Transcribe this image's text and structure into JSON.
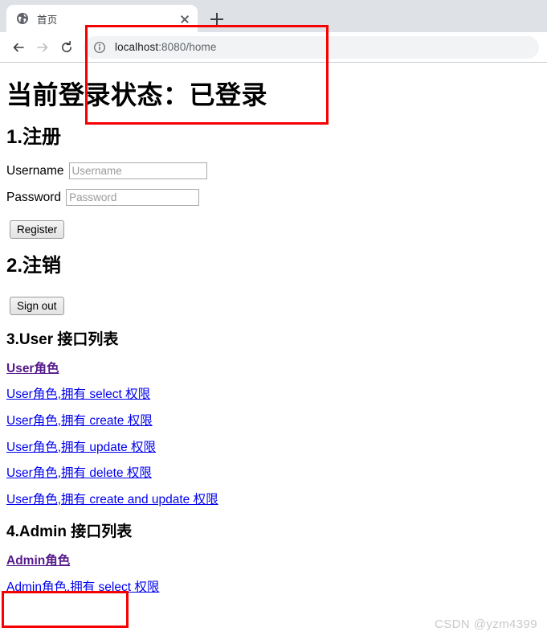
{
  "browser": {
    "tab": {
      "title": "首页",
      "favicon": "globe-icon",
      "close_label": "×"
    },
    "newtab_label": "+",
    "nav": {
      "back_label": "←",
      "forward_label": "→",
      "reload_label": "⟳"
    },
    "omnibox": {
      "info_icon": "info-circle-icon",
      "url_host": "localhost",
      "url_rest": ":8080/home",
      "url_full": "localhost:8080/home"
    }
  },
  "page": {
    "status_heading": "当前登录状态：已登录",
    "section1": {
      "heading": "1.注册",
      "username_label": "Username",
      "username_placeholder": "Username",
      "username_value": "",
      "password_label": "Password",
      "password_placeholder": "Password",
      "password_value": "",
      "register_button": "Register"
    },
    "section2": {
      "heading": "2.注销",
      "signout_button": "Sign out"
    },
    "section3": {
      "heading": "3.User 接口列表",
      "links": [
        {
          "text": "User角色",
          "visited": true
        },
        {
          "text": "User角色,拥有 select 权限",
          "visited": false
        },
        {
          "text": "User角色,拥有 create 权限",
          "visited": false
        },
        {
          "text": "User角色,拥有 update 权限",
          "visited": false
        },
        {
          "text": "User角色,拥有 delete 权限",
          "visited": false
        },
        {
          "text": "User角色,拥有 create and update 权限",
          "visited": false
        }
      ]
    },
    "section4": {
      "heading": "4.Admin 接口列表",
      "links": [
        {
          "text": "Admin角色",
          "visited": true
        },
        {
          "text": "Admin角色,拥有 select 权限",
          "visited": false
        }
      ]
    }
  },
  "annotations": {
    "highlight_color": "#f60000",
    "boxes": [
      {
        "name": "url-highlight"
      },
      {
        "name": "admin-link-highlight"
      }
    ]
  },
  "watermark": "CSDN @yzm4399"
}
